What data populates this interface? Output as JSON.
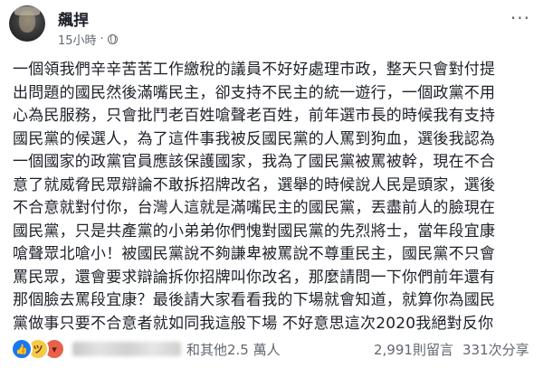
{
  "post": {
    "author": "飆捍",
    "time": "15小時",
    "privacy_icon": "globe-icon",
    "menu_icon": "more-options-icon",
    "menu_glyph": "···",
    "lines": [
      "一個領我們辛辛苦苦工作繳稅的議員不好好處理市政，整天只會對付提",
      "出問題的國民然後滿嘴民主，卻支持不民主的統一遊行，一個政黨不用",
      "心為民服務，只會批鬥老百姓嗆聲老百姓，前年選市長的時候我有支持",
      "國民黨的候選人，為了這件事我被反國民黨的人罵到狗血，選後我認為",
      "一個國家的政黨官員應該保護國家，我為了國民黨被罵被幹，現在不合",
      "意了就威脅民眾辯論不敢拆招牌改名，選舉的時候說人民是頭家，選後",
      "不合意就對付你，台灣人這就是滿嘴民主的國民黨，丟盡前人的臉現在",
      "國民黨，只是共產黨的小弟弟你們愧對國民黨的先烈將士，當年段宜康",
      "嗆聲眾北嗆小！被國民黨說不夠謙卑被罵說不尊重民主，國民黨不只會",
      "罵民眾，還會要求辯論拆你招牌叫你改名，那麼請問一下你們前年還有",
      "那個臉去罵段宜康？最後請大家看看我的下場就會知道，就算你為國民",
      "黨做事只要不合意者就如同我這般下場 不好意思這次2020我絕對反你"
    ]
  },
  "footer": {
    "reactions": [
      "like-icon",
      "haha-icon",
      "angry-icon"
    ],
    "reaction_glyphs": [
      "👍",
      "ツ",
      "▾"
    ],
    "others_text": "和其他2.5 萬人",
    "comments_text": "2,991則留言",
    "shares_text": "331次分享"
  },
  "colors": {
    "text": "#1d2129",
    "meta": "#616770",
    "like": "#1877f2",
    "haha": "#f7c948",
    "angry": "#e8624a"
  }
}
